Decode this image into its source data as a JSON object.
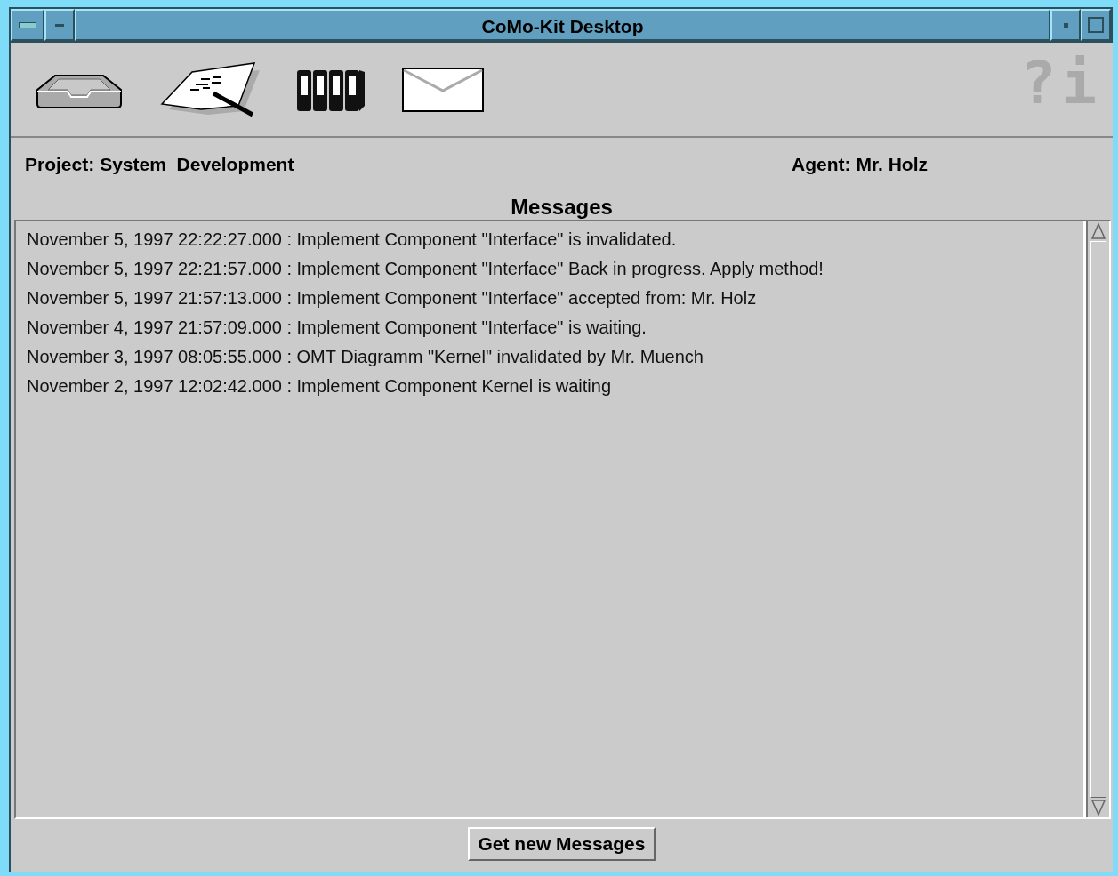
{
  "window": {
    "title": "CoMo-Kit Desktop"
  },
  "toolbar": {
    "help": "?",
    "info": "i"
  },
  "project": {
    "label": "Project:",
    "value": "System_Development"
  },
  "agent": {
    "label": "Agent:",
    "value": "Mr. Holz"
  },
  "messages": {
    "title": "Messages",
    "items": [
      "November 5, 1997 22:22:27.000 : Implement Component \"Interface\" is invalidated.",
      "November 5, 1997 22:21:57.000 : Implement Component \"Interface\" Back in progress. Apply method!",
      "November 5, 1997 21:57:13.000 : Implement Component \"Interface\" accepted from: Mr. Holz",
      "November 4, 1997 21:57:09.000 : Implement Component \"Interface\" is waiting.",
      "November 3, 1997 08:05:55.000 : OMT Diagramm \"Kernel\" invalidated by Mr. Muench",
      "November 2, 1997 12:02:42.000 : Implement Component Kernel is waiting"
    ]
  },
  "button": "Get new Messages"
}
